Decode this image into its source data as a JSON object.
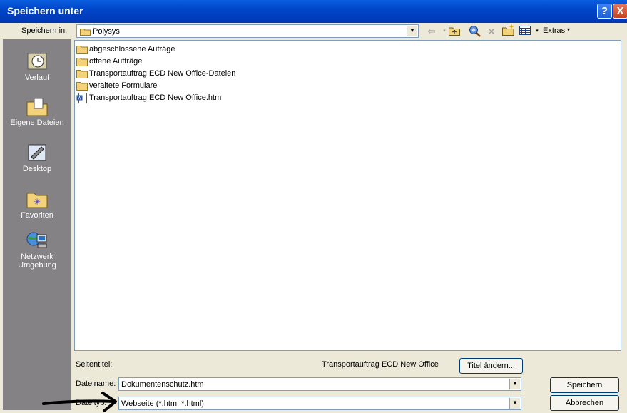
{
  "window": {
    "title": "Speichern unter",
    "help_glyph": "?",
    "close_glyph": "X"
  },
  "toolbar": {
    "save_in_label": "Speichern in:",
    "save_in_label_ul": "i",
    "folder": "Polysys",
    "extras_label": "Extras"
  },
  "places": [
    {
      "label": "Verlauf",
      "icon": "history-icon"
    },
    {
      "label": "Eigene Dateien",
      "icon": "my-documents-icon"
    },
    {
      "label": "Desktop",
      "icon": "desktop-icon"
    },
    {
      "label": "Favoriten",
      "icon": "favorites-icon"
    },
    {
      "label": "Netzwerk Umgebung",
      "icon": "network-icon"
    }
  ],
  "files": [
    {
      "name": "abgeschlossene Aufräge",
      "type": "folder"
    },
    {
      "name": "offene Aufträge",
      "type": "folder"
    },
    {
      "name": "Transportauftrag ECD New Office-Dateien",
      "type": "folder"
    },
    {
      "name": "veraltete Formulare",
      "type": "folder"
    },
    {
      "name": "Transportauftrag ECD New Office.htm",
      "type": "word-html-file"
    }
  ],
  "form": {
    "page_title_label": "Seitentitel:",
    "page_title_value": "Transportauftrag ECD New Office",
    "change_title_button": "Titel ändern...",
    "filename_label": "Dateiname:",
    "filename_value": "Dokumentenschutz.htm",
    "filetype_label": "Dateityp:",
    "filetype_value": "Webseite (*.htm; *.html)",
    "save_button": "Speichern",
    "cancel_button": "Abbrechen"
  },
  "colors": {
    "titlebar": "#0046c8",
    "dialog_bg": "#ECE9D8",
    "places_bg": "#848284",
    "annotation_arrow": "#000000"
  }
}
